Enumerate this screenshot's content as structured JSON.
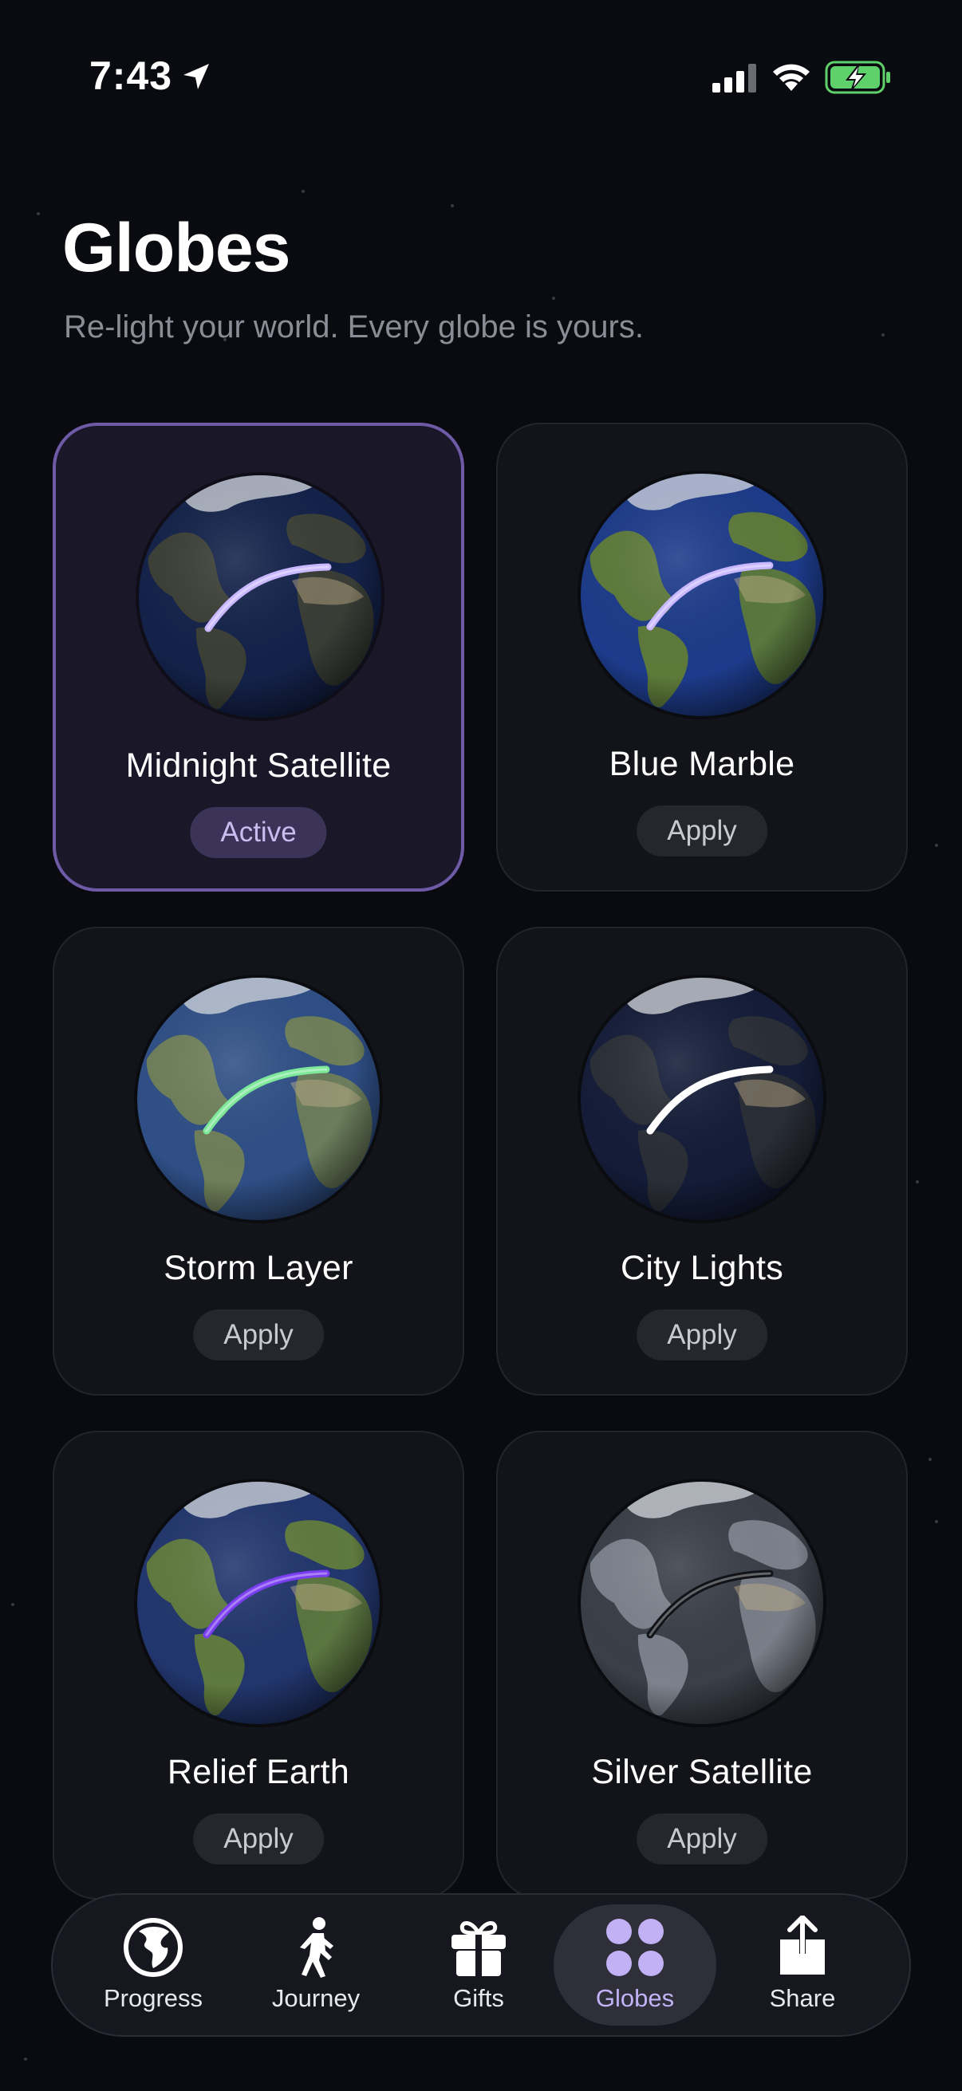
{
  "status_bar": {
    "time": "7:43"
  },
  "header": {
    "title": "Globes",
    "subtitle": "Re-light your world. Every globe is yours."
  },
  "globes": [
    {
      "name": "Midnight Satellite",
      "action": "Active",
      "state": "active",
      "arc_color": "#c9b8ff",
      "ocean": "#14224a",
      "land": "#3b3f35"
    },
    {
      "name": "Blue Marble",
      "action": "Apply",
      "state": "inactive",
      "arc_color": "#c9b8ff",
      "ocean": "#1d3b8a",
      "land": "#5d7a3a"
    },
    {
      "name": "Storm Layer",
      "action": "Apply",
      "state": "inactive",
      "arc_color": "#7ee89a",
      "ocean": "#2f4f86",
      "land": "#6f7f5a"
    },
    {
      "name": "City Lights",
      "action": "Apply",
      "state": "inactive",
      "arc_color": "#ffffff",
      "ocean": "#141c38",
      "land": "#2a2e36"
    },
    {
      "name": "Relief Earth",
      "action": "Apply",
      "state": "inactive",
      "arc_color": "#7b3df0",
      "ocean": "#22366e",
      "land": "#5f7a3e"
    },
    {
      "name": "Silver Satellite",
      "action": "Apply",
      "state": "inactive",
      "arc_color": "#111318",
      "ocean": "#3a3f48",
      "land": "#7c828c"
    }
  ],
  "tabbar": {
    "tabs": [
      {
        "label": "Progress",
        "icon": "globe-icon"
      },
      {
        "label": "Journey",
        "icon": "walking-icon"
      },
      {
        "label": "Gifts",
        "icon": "gift-icon"
      },
      {
        "label": "Globes",
        "icon": "grid-icon",
        "selected": true
      },
      {
        "label": "Share",
        "icon": "share-icon"
      }
    ]
  }
}
